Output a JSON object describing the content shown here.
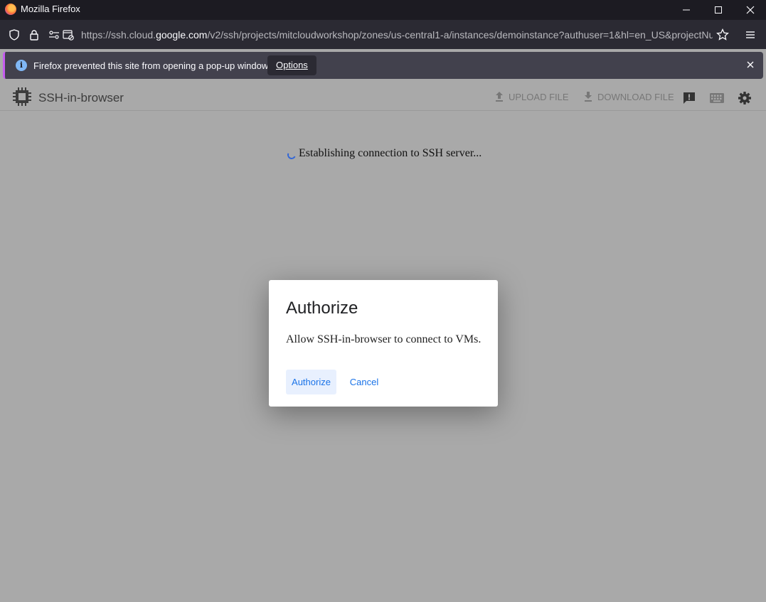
{
  "window": {
    "title": "Mozilla Firefox"
  },
  "navbar": {
    "url_prefix": "https://ssh.cloud.",
    "url_domain": "google.com",
    "url_suffix": "/v2/ssh/projects/mitcloudworkshop/zones/us-central1-a/instances/demoinstance?authuser=1&hl=en_US&projectNu"
  },
  "notification": {
    "message": "Firefox prevented this site from opening a pop-up window.",
    "options_label": "Options"
  },
  "app": {
    "title": "SSH-in-browser",
    "upload_label": "UPLOAD FILE",
    "download_label": "DOWNLOAD FILE"
  },
  "status": {
    "text": "Establishing connection to SSH server..."
  },
  "dialog": {
    "title": "Authorize",
    "body": "Allow SSH-in-browser to connect to VMs.",
    "authorize_label": "Authorize",
    "cancel_label": "Cancel"
  },
  "colors": {
    "accent": "#1a73e8",
    "overlay": "#a9a9a9",
    "notification_stripe": "#c55cf0"
  },
  "icons": [
    "firefox-logo",
    "minimize-icon",
    "maximize-icon",
    "close-icon",
    "shield-icon",
    "lock-icon",
    "permissions-icon",
    "popup-blocked-icon",
    "star-icon",
    "menu-icon",
    "info-icon",
    "chip-icon",
    "upload-icon",
    "download-icon",
    "feedback-icon",
    "keyboard-icon",
    "gear-icon"
  ]
}
